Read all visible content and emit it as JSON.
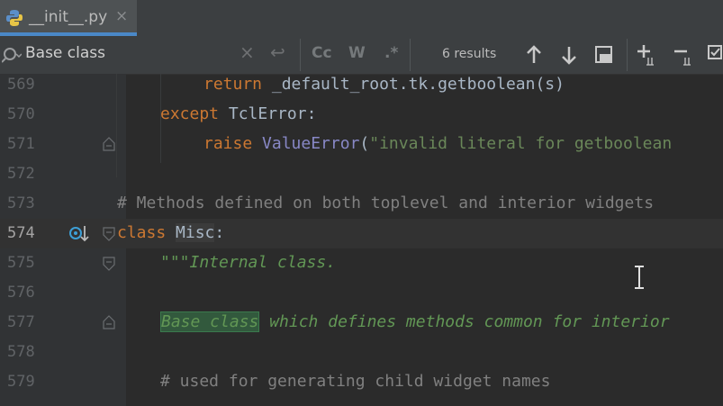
{
  "tab": {
    "title": "__init__.py",
    "close": "×",
    "icon": "python-file-icon"
  },
  "search": {
    "query": "Base class",
    "clear": "×",
    "newline": "↩",
    "match_case": "Cc",
    "words": "W",
    "regex": ".*",
    "results": "6 results"
  },
  "lines": [
    {
      "n": "569"
    },
    {
      "n": "570"
    },
    {
      "n": "571"
    },
    {
      "n": "572"
    },
    {
      "n": "573"
    },
    {
      "n": "574"
    },
    {
      "n": "575"
    },
    {
      "n": "576"
    },
    {
      "n": "577"
    },
    {
      "n": "578"
    },
    {
      "n": "579"
    }
  ],
  "code": {
    "l569_kw": "return",
    "l569_rest": " _default_root.tk.getboolean(s)",
    "l570_kw": "except",
    "l570_rest": " TclError:",
    "l571_kw": "raise",
    "l571_builtin": "ValueError",
    "l571_p": "(",
    "l571_str": "\"invalid literal for getboolean",
    "l573_comment": "# Methods defined on both toplevel and interior widgets",
    "l574_kw": "class",
    "l574_name": "Misc",
    "l574_colon": ":",
    "l575_doc": "\"\"\"Internal class.",
    "l577_match": "Base class",
    "l577_doc": " which defines methods common for interior",
    "l579_comment": "# used for generating child widget names"
  },
  "colors": {
    "accent": "#4a88c7",
    "keyword": "#cc7832",
    "docstring": "#629755",
    "comment": "#808080",
    "match_highlight": "#32593d"
  }
}
